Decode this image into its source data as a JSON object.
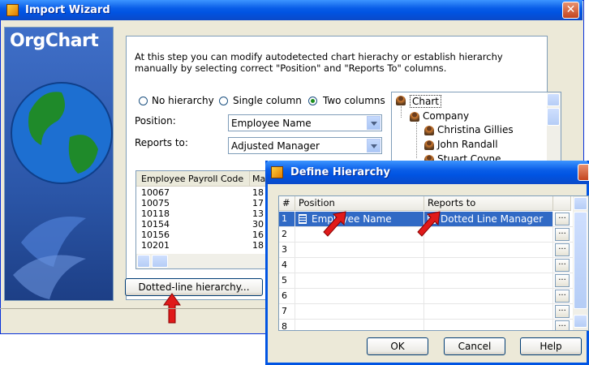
{
  "main_window": {
    "title": "Import Wizard",
    "brand": "OrgChart",
    "intro": "At this step you can modify autodetected chart hierachy or establish hierarchy manually by selecting correct \"Position\" and \"Reports To\" columns.",
    "hierarchy_options": [
      {
        "label": "No hierarchy",
        "selected": false
      },
      {
        "label": "Single column",
        "selected": false
      },
      {
        "label": "Two columns",
        "selected": true
      }
    ],
    "position_label": "Position:",
    "position_value": "Employee Name",
    "reports_to_label": "Reports to:",
    "reports_to_value": "Adjusted Manager",
    "tree": {
      "root": "Chart",
      "company": "Company",
      "people": [
        "Christina Gillies",
        "John Randall",
        "Stuart Coyne"
      ]
    },
    "grid": {
      "columns": [
        "Employee Payroll Code",
        "Ma"
      ],
      "rows": [
        [
          "10067",
          "18"
        ],
        [
          "10075",
          "17"
        ],
        [
          "10118",
          "13"
        ],
        [
          "10154",
          "30"
        ],
        [
          "10156",
          "16"
        ],
        [
          "10201",
          "18"
        ]
      ]
    },
    "dotted_button": "Dotted-line hierarchy..."
  },
  "dialog": {
    "title": "Define Hierarchy",
    "columns": [
      "#",
      "Position",
      "Reports to"
    ],
    "rows": [
      {
        "num": "1",
        "position": "Employee Name",
        "reports_to": "Dotted Line Manager",
        "selected": true
      },
      {
        "num": "2",
        "position": "",
        "reports_to": "",
        "selected": false
      },
      {
        "num": "3",
        "position": "",
        "reports_to": "",
        "selected": false
      },
      {
        "num": "4",
        "position": "",
        "reports_to": "",
        "selected": false
      },
      {
        "num": "5",
        "position": "",
        "reports_to": "",
        "selected": false
      },
      {
        "num": "6",
        "position": "",
        "reports_to": "",
        "selected": false
      },
      {
        "num": "7",
        "position": "",
        "reports_to": "",
        "selected": false
      },
      {
        "num": "8",
        "position": "",
        "reports_to": "",
        "selected": false
      }
    ],
    "ellipsis": "...",
    "ok": "OK",
    "cancel": "Cancel",
    "help": "Help"
  },
  "colors": {
    "titlebar": "#0054e3",
    "selection": "#316ac5",
    "annotation_arrow": "#e01a1a"
  }
}
